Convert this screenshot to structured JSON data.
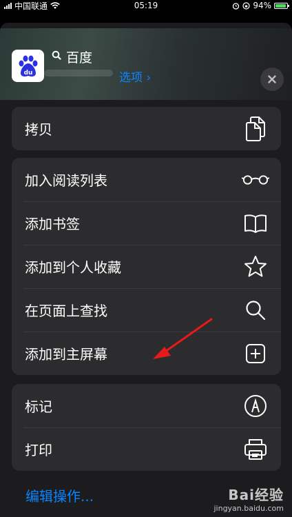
{
  "status_bar": {
    "carrier": "中国联通",
    "time": "05:19",
    "battery_percent": "94%",
    "battery_level": 0.94
  },
  "header": {
    "app_name": "百度",
    "options_label": "选项 ›",
    "app_icon_text": "du",
    "close_icon": "close-icon"
  },
  "groups": [
    [
      {
        "label": "拷贝",
        "icon": "copy-icon"
      }
    ],
    [
      {
        "label": "加入阅读列表",
        "icon": "glasses-icon"
      },
      {
        "label": "添加书签",
        "icon": "book-icon"
      },
      {
        "label": "添加到个人收藏",
        "icon": "star-icon"
      },
      {
        "label": "在页面上查找",
        "icon": "search-icon"
      },
      {
        "label": "添加到主屏幕",
        "icon": "add-square-icon"
      }
    ],
    [
      {
        "label": "标记",
        "icon": "markup-icon"
      },
      {
        "label": "打印",
        "icon": "printer-icon"
      }
    ]
  ],
  "edit_actions_label": "编辑操作...",
  "watermark": {
    "brand": "Bai经验",
    "url": "jingyan.baidu.com"
  },
  "colors": {
    "accent": "#0a84ff",
    "annotation_arrow": "#e8191b"
  }
}
